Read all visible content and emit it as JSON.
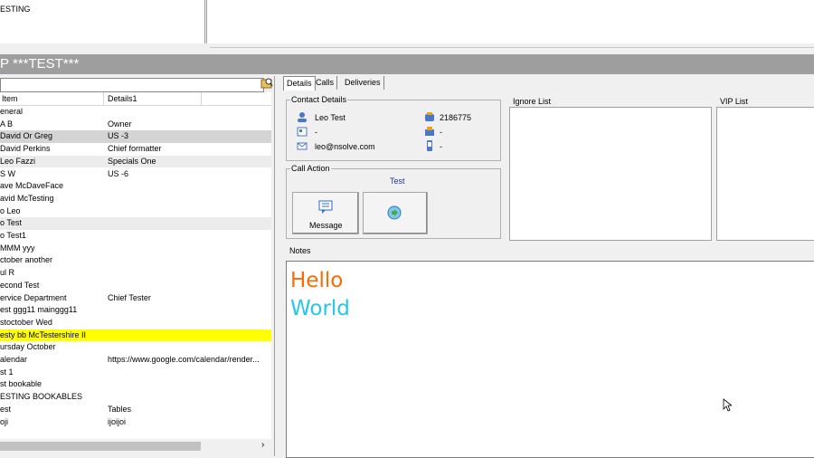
{
  "top_left_list": {
    "item": "ESTING"
  },
  "titlebar": {
    "mark": "P",
    "title": "***TEST***"
  },
  "list": {
    "columns": [
      "Item",
      "Details1"
    ],
    "rows": [
      {
        "item": "eneral",
        "details": ""
      },
      {
        "item": "A B",
        "details": "Owner"
      },
      {
        "item": "David Or Greg",
        "details": "US -3"
      },
      {
        "item": "David Perkins",
        "details": "Chief formatter"
      },
      {
        "item": "Leo Fazzi",
        "details": "Specials One"
      },
      {
        "item": "S W",
        "details": "US -6"
      },
      {
        "item": "ave McDaveFace",
        "details": ""
      },
      {
        "item": "avid McTesting",
        "details": ""
      },
      {
        "item": "o Leo",
        "details": ""
      },
      {
        "item": "o Test",
        "details": ""
      },
      {
        "item": "o Test1",
        "details": ""
      },
      {
        "item": "MMM yyy",
        "details": ""
      },
      {
        "item": "ctober another",
        "details": ""
      },
      {
        "item": "ul R",
        "details": ""
      },
      {
        "item": "econd Test",
        "details": ""
      },
      {
        "item": "ervice Department",
        "details": "Chief Tester"
      },
      {
        "item": "est ggg11 mainggg11",
        "details": ""
      },
      {
        "item": "stoctober Wed",
        "details": ""
      },
      {
        "item": "esty bb McTestershire II",
        "details": ""
      },
      {
        "item": "ursday October",
        "details": ""
      },
      {
        "item": "alendar",
        "details": "https://www.google.com/calendar/render..."
      },
      {
        "item": "st 1",
        "details": ""
      },
      {
        "item": "st bookable",
        "details": ""
      },
      {
        "item": "ESTING BOOKABLES",
        "details": ""
      },
      {
        "item": "est",
        "details": "Tables"
      },
      {
        "item": "oji",
        "details": "ijoijoi"
      }
    ]
  },
  "tabs": [
    "Details",
    "Calls",
    "Deliveries"
  ],
  "contact": {
    "legend": "Contact Details",
    "name": "Leo Test",
    "phone": "2186775",
    "company": "-",
    "fax": "-",
    "email": "leo@nsolve.com",
    "mobile": "-"
  },
  "call_action": {
    "legend": "Call Action",
    "label": "Test",
    "message_button": "Message"
  },
  "ignore_list": {
    "label": "Ignore List"
  },
  "vip_list": {
    "label": "VIP List"
  },
  "notes": {
    "label": "Notes",
    "line1": "Hello",
    "line2": "World"
  },
  "colors": {
    "titlebar": "#9e9e9e",
    "highlight_row": "#ffff00",
    "hello": "#ff6a00",
    "world": "#26c6e8"
  }
}
